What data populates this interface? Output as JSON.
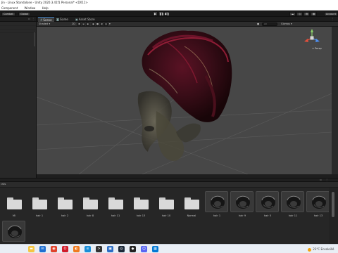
{
  "window": {
    "title": "Jin - Linux Standalone - Unity 2020.3.41f1 Personal* <DX11>"
  },
  "menu": {
    "items": [
      "Component",
      "Window",
      "Help"
    ]
  },
  "toolbar": {
    "left_buttons": [
      "Combat",
      "Global"
    ],
    "account_label": "Account",
    "colors": {
      "accent": "#3a79bb"
    }
  },
  "scene": {
    "tabs": [
      {
        "label": "Scene",
        "icon": "hash-icon",
        "active": true
      },
      {
        "label": "Game",
        "icon": "gamepad-icon",
        "active": false
      },
      {
        "label": "Asset Store",
        "icon": "store-icon",
        "active": false
      }
    ],
    "shading_mode": "Shaded",
    "mode_2d": "2D",
    "search_all": "All",
    "gizmos_label": "Gizmos",
    "projection_label": "< Persp"
  },
  "project": {
    "breadcrumb": "rails",
    "tiles_row1": [
      "Mi",
      "hair 1",
      "hair 2",
      "hair 8",
      "hair 11",
      "hair 13",
      "hair 10",
      "Normal",
      "hair 1",
      "hair 9",
      "hair 5",
      "hair 11",
      "hair 13"
    ],
    "tile_types_row1": [
      "folder",
      "folder",
      "folder",
      "folder",
      "folder",
      "folder",
      "folder",
      "folder",
      "thumb",
      "thumb",
      "thumb",
      "thumb",
      "thumb"
    ],
    "tiles_row2": [
      ""
    ],
    "tile_types_row2": [
      "thumb"
    ]
  },
  "taskbar": {
    "weather_temp": "23°C",
    "weather_desc": "Ensoleillé",
    "icons": [
      "file-explorer-icon",
      "mail-icon",
      "chrome-icon",
      "opera-icon",
      "firefox-icon",
      "edge-icon",
      "terminal-icon",
      "photos-icon",
      "steam-icon",
      "unity-icon",
      "discord-icon",
      "store-icon"
    ]
  }
}
